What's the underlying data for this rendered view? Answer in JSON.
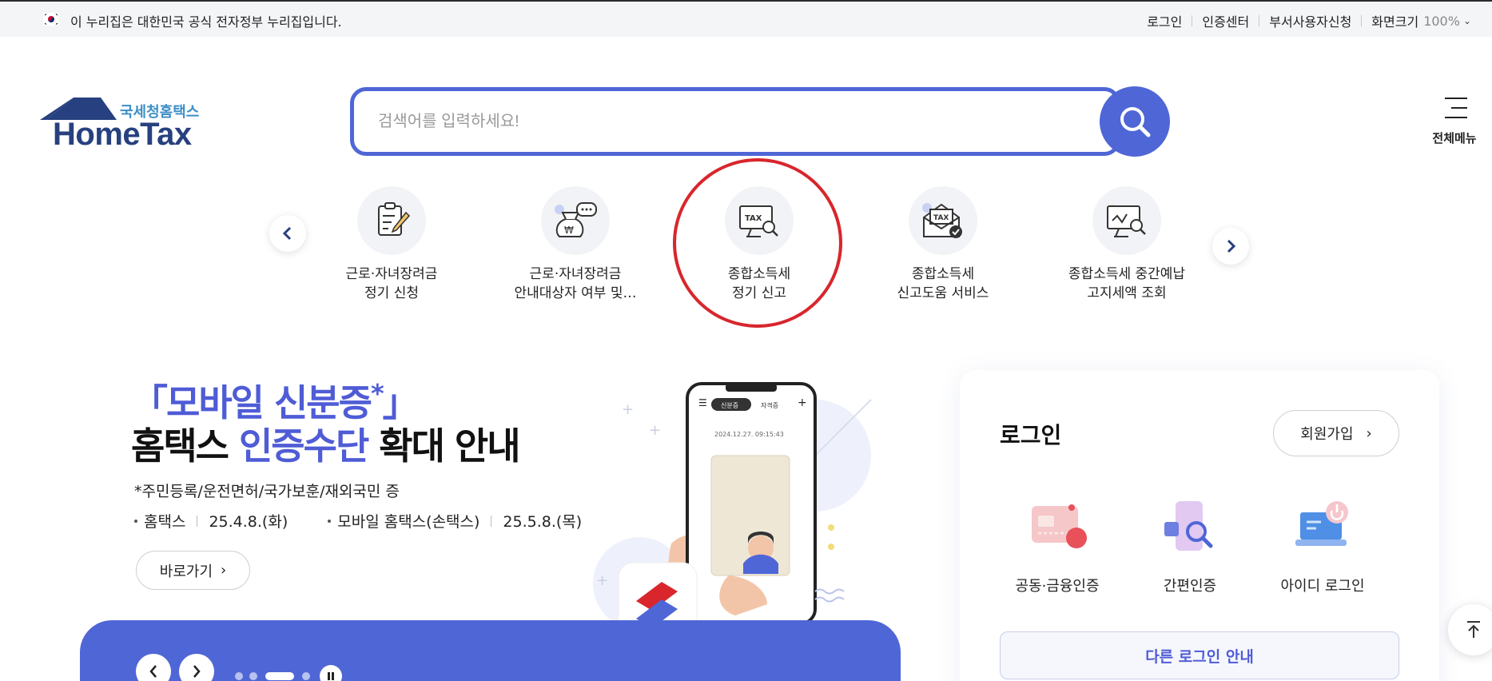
{
  "gov_bar": {
    "text": "이 누리집은 대한민국 공식 전자정부 누리집입니다.",
    "links": [
      "로그인",
      "인증센터",
      "부서사용자신청"
    ],
    "zoom_label": "화면크기",
    "zoom_value": "100%"
  },
  "header": {
    "logo_kr": "국세청홈택스",
    "logo_en": "HomeTax",
    "search_placeholder": "검색어를 입력하세요!",
    "all_menu_label": "전체메뉴"
  },
  "quick_menu": [
    {
      "line1": "근로·자녀장려금",
      "line2": "정기 신청",
      "icon": "clipboard-pen-icon"
    },
    {
      "line1": "근로·자녀장려금",
      "line2": "안내대상자 여부 및…",
      "icon": "money-bag-chat-icon"
    },
    {
      "line1": "종합소득세",
      "line2": "정기 신고",
      "icon": "tax-monitor-search-icon",
      "highlighted": true
    },
    {
      "line1": "종합소득세",
      "line2": "신고도움 서비스",
      "icon": "tax-envelope-check-icon"
    },
    {
      "line1": "종합소득세 중간예납",
      "line2": "고지세액 조회",
      "icon": "monitor-search-won-icon"
    }
  ],
  "banner": {
    "title_line1": "「모바일 신분증",
    "title_star": "*",
    "title_close": "」",
    "title_line2_a": "홈택스 ",
    "title_line2_hl": "인증수단",
    "title_line2_b": " 확대 안내",
    "subtitle": "*주민등록/운전면허/국가보훈/재외국민 증",
    "date1_label": "홈택스",
    "date1_value": "25.4.8.(화)",
    "date2_label": "모바일 홈택스(손택스)",
    "date2_value": "25.5.8.(목)",
    "go_button": "바로가기",
    "phone_tab1": "신분증",
    "phone_tab2": "자격증",
    "phone_time": "2024.12.27. 09:15:43",
    "pager_total": 4,
    "pager_active": 3
  },
  "login": {
    "title": "로그인",
    "join_button": "회원가입",
    "options": [
      {
        "label": "공동·금융인증",
        "icon": "certificate-card-icon"
      },
      {
        "label": "간편인증",
        "icon": "phone-search-icon"
      },
      {
        "label": "아이디 로그인",
        "icon": "laptop-power-icon"
      }
    ],
    "other_login": "다른 로그인 안내"
  },
  "colors": {
    "primary": "#4f66d6",
    "highlight_ring": "#d8262c",
    "logo_navy": "#27407f",
    "logo_sky": "#3c8ec6"
  }
}
